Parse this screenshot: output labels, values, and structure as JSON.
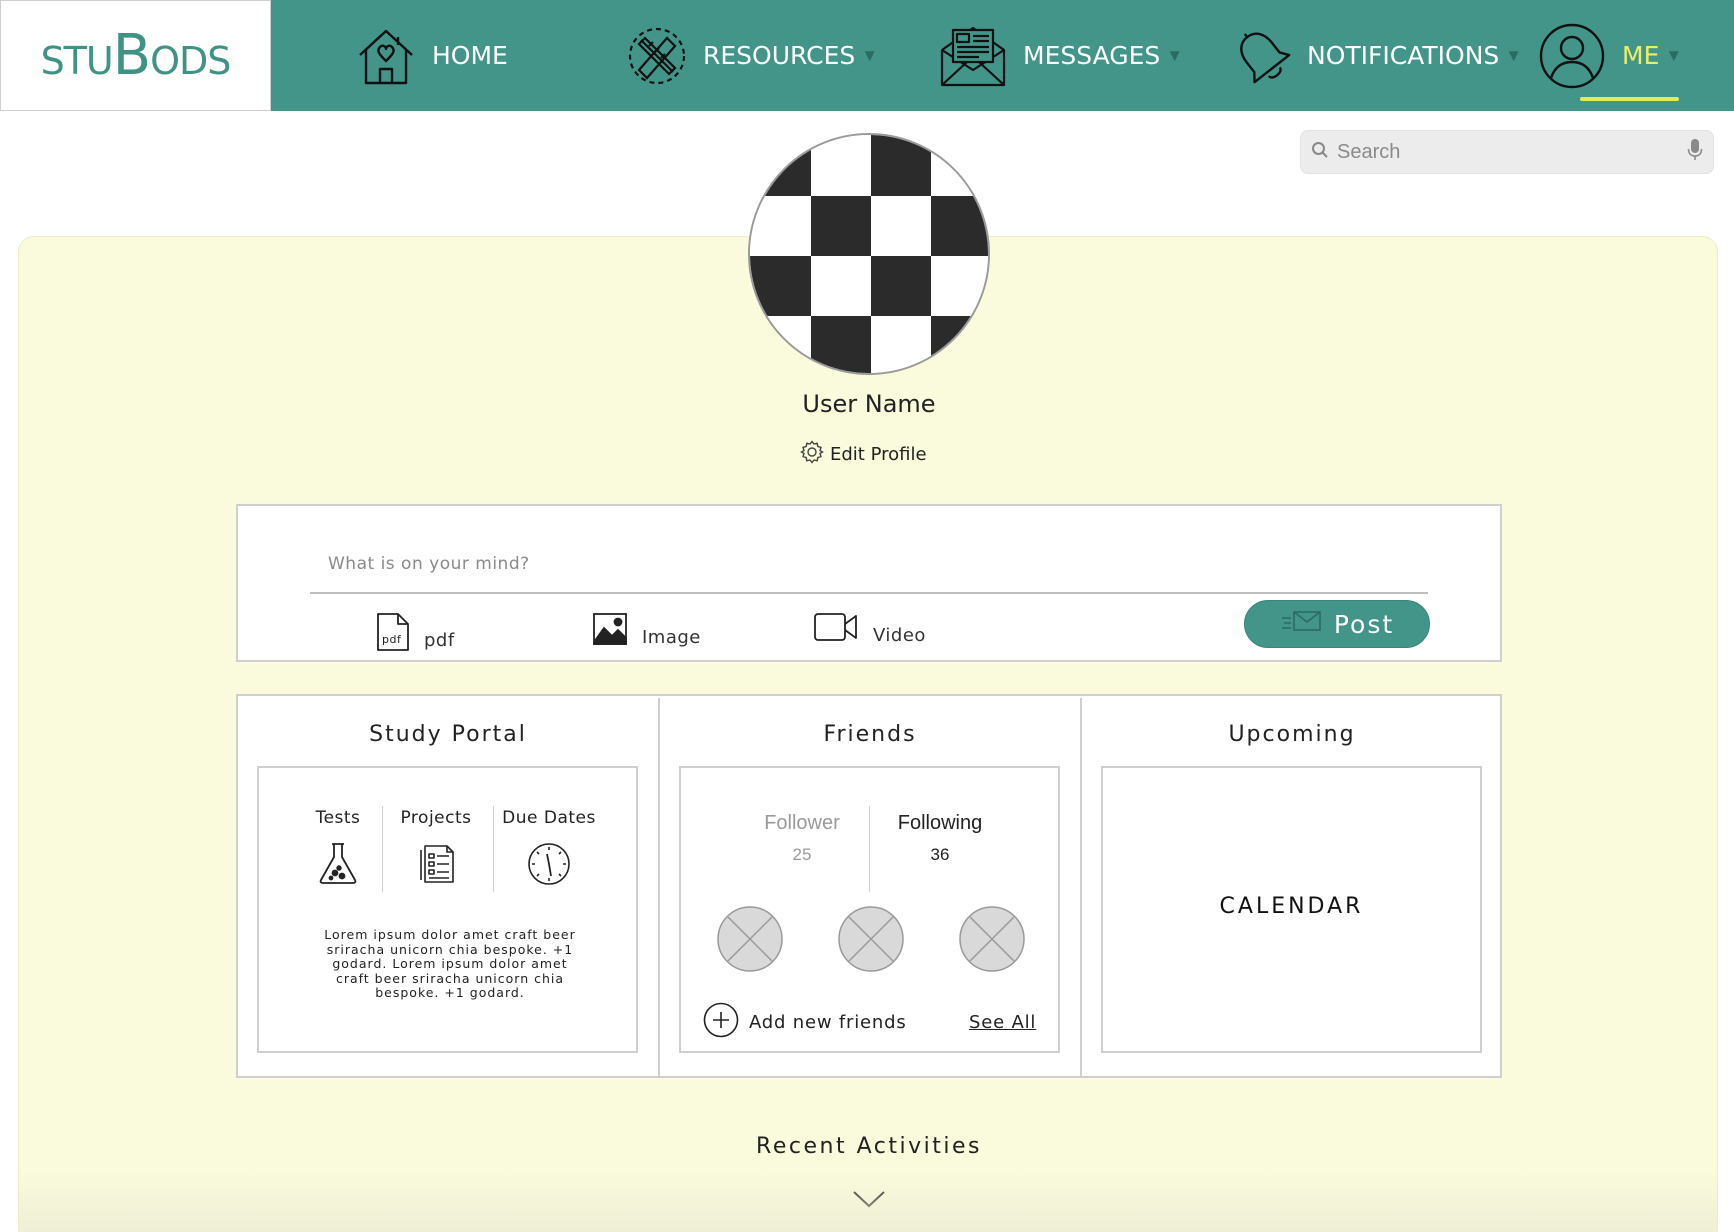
{
  "app": {
    "logo_small_1": "STU",
    "logo_big_1": "B",
    "logo_small_2": "ODS"
  },
  "colors": {
    "nav_bg": "#43958a",
    "accent": "#ecef66",
    "panel_bg": "#fafadc"
  },
  "nav": {
    "items": [
      {
        "label": "HOME",
        "icon": "home-heart-icon",
        "has_caret": false
      },
      {
        "label": "RESOURCES",
        "icon": "pencil-ruler-icon",
        "has_caret": true
      },
      {
        "label": "MESSAGES",
        "icon": "envelope-letter-icon",
        "has_caret": true
      },
      {
        "label": "NOTIFICATIONS",
        "icon": "bell-icon",
        "has_caret": true
      },
      {
        "label": "ME",
        "icon": "user-circle-icon",
        "has_caret": true,
        "active": true
      }
    ],
    "caret": "▼"
  },
  "search": {
    "placeholder": "Search",
    "icon": "search-icon",
    "voice_icon": "microphone-icon"
  },
  "profile": {
    "user_name": "User Name",
    "edit_label": "Edit Profile",
    "edit_icon": "gear-icon"
  },
  "composer": {
    "placeholder": "What is on your mind?",
    "attachments": [
      {
        "label": "pdf",
        "icon": "pdf-file-icon"
      },
      {
        "label": "Image",
        "icon": "image-icon"
      },
      {
        "label": "Video",
        "icon": "video-camera-icon"
      }
    ],
    "post_label": "Post",
    "pdf_glyph": "pdf"
  },
  "study_portal": {
    "title": "Study Portal",
    "items": [
      {
        "label": "Tests",
        "icon": "flask-icon"
      },
      {
        "label": "Projects",
        "icon": "document-list-icon"
      },
      {
        "label": "Due Dates",
        "icon": "clock-icon"
      }
    ],
    "description": "Lorem ipsum dolor amet craft beer sriracha unicorn chia bespoke. +1 godard. Lorem ipsum dolor amet craft beer sriracha unicorn chia bespoke. +1 godard."
  },
  "friends": {
    "title": "Friends",
    "follower_label": "Follower",
    "follower_count": "25",
    "following_label": "Following",
    "following_count": "36",
    "add_label": "Add new friends",
    "see_all_label": "See All"
  },
  "upcoming": {
    "title": "Upcoming",
    "calendar_label": "CALENDAR"
  },
  "recent": {
    "title": "Recent Activities"
  }
}
